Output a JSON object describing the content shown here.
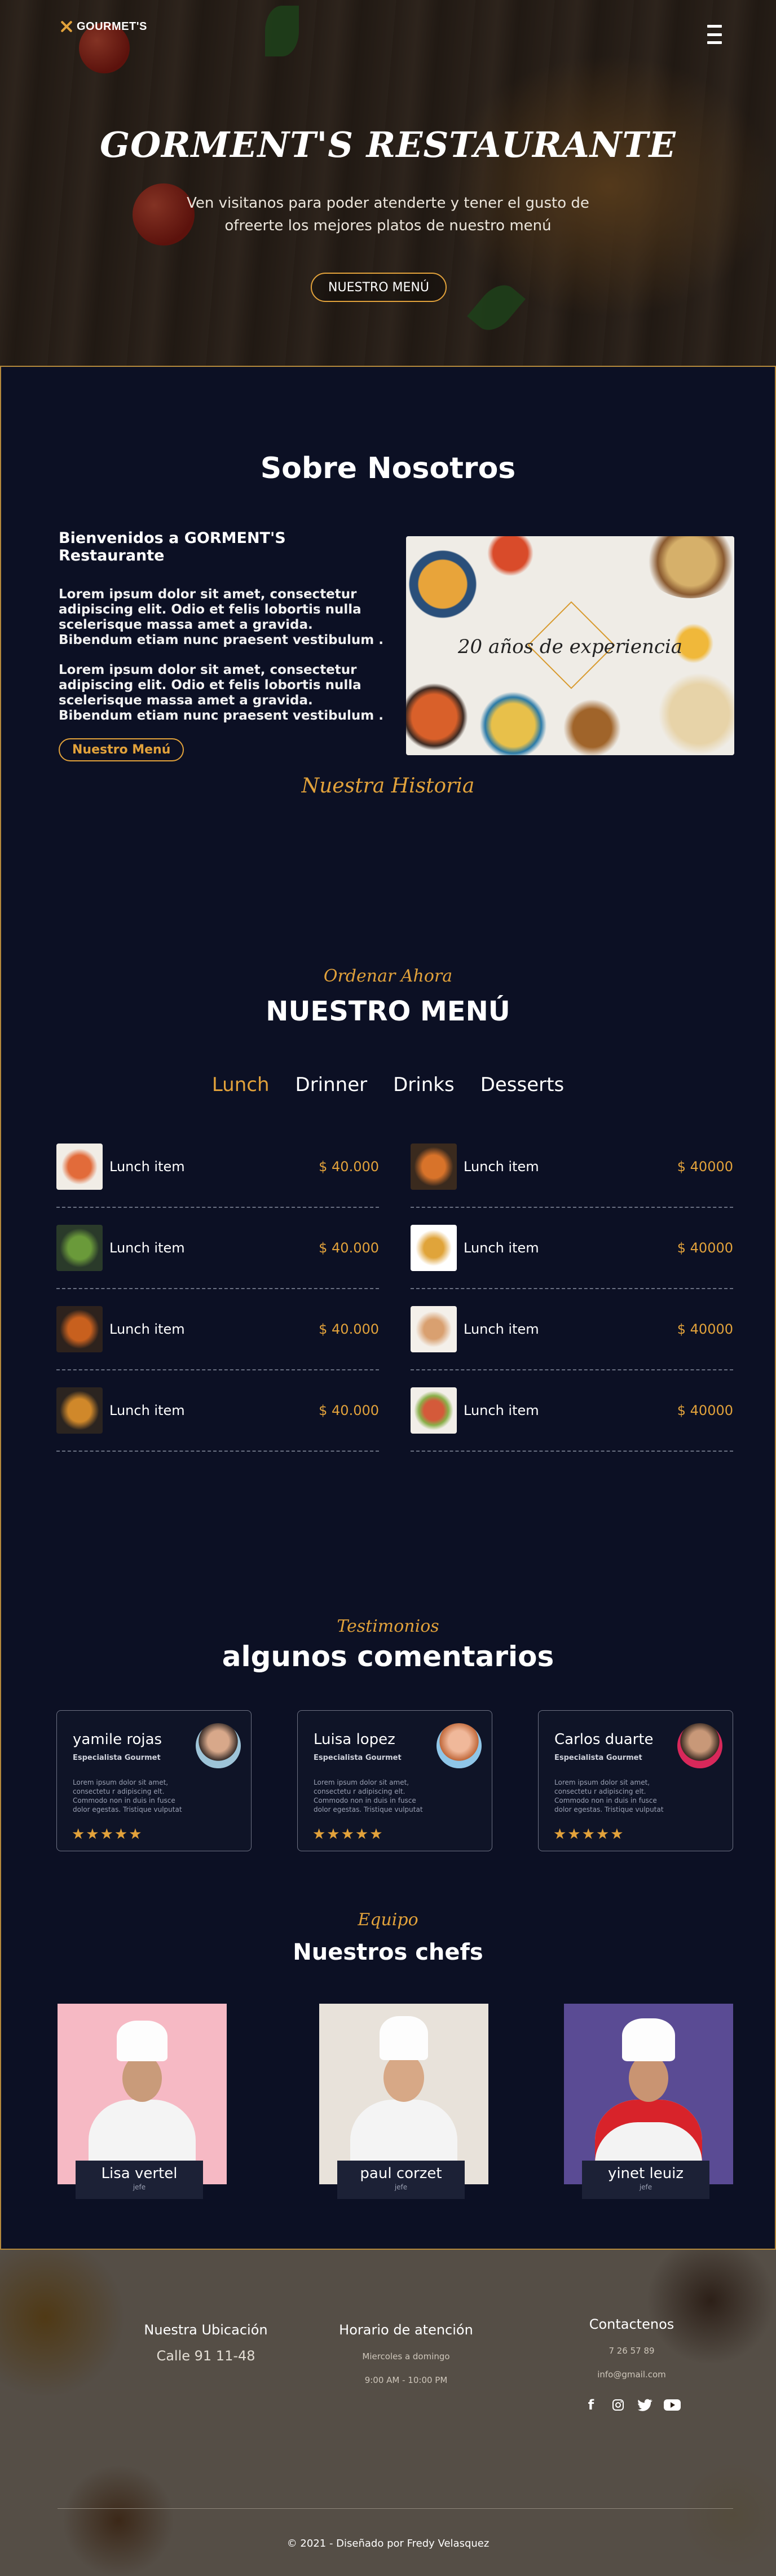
{
  "brand": {
    "logo_text": "GOURMET'S"
  },
  "hero": {
    "title": "GORMENT'S RESTAURANTE",
    "subtitle": "Ven visitanos para poder atenderte y tener el gusto de ofreerte los mejores platos de nuestro menú",
    "cta": "NUESTRO MENÚ"
  },
  "about": {
    "kicker": "Nuestra Historia",
    "title": "Sobre Nosotros",
    "heading": "Bienvenidos a GORMENT'S Restaurante",
    "paragraphs": [
      "Lorem ipsum dolor sit amet, consectetur adipiscing elit. Odio et felis lobortis nulla scelerisque massa amet a gravida. Bibendum etiam nunc praesent vestibulum .",
      "Lorem ipsum dolor sit amet, consectetur adipiscing elit. Odio et felis lobortis nulla scelerisque massa amet a gravida. Bibendum etiam nunc praesent vestibulum ."
    ],
    "button": "Nuestro Menú",
    "image_caption": "20 años de experiencia"
  },
  "menu": {
    "kicker": "Ordenar Ahora",
    "title": "NUESTRO MENÚ",
    "tabs": [
      "Lunch",
      "Drinner",
      "Drinks",
      "Desserts"
    ],
    "active_tab": "Lunch",
    "items": [
      {
        "name": "Lunch item",
        "price": "$ 40.000"
      },
      {
        "name": "Lunch item",
        "price": "$ 40000"
      },
      {
        "name": "Lunch item",
        "price": "$ 40.000"
      },
      {
        "name": "Lunch item",
        "price": "$ 40000"
      },
      {
        "name": "Lunch item",
        "price": "$ 40.000"
      },
      {
        "name": "Lunch item",
        "price": "$ 40000"
      },
      {
        "name": "Lunch item",
        "price": "$ 40.000"
      },
      {
        "name": "Lunch item",
        "price": "$ 40000"
      }
    ]
  },
  "testimonials": {
    "kicker": "Testimonios",
    "title": "algunos comentarios",
    "cards": [
      {
        "name": "yamile rojas",
        "role": "Especialista Gourmet",
        "text": "Lorem ipsum dolor sit amet, consectetu r adipiscing elt. Commodo non in duis in fusce dolor egestas. Tristique vulputat",
        "stars": "★★★★★"
      },
      {
        "name": "Luisa lopez",
        "role": "Especialista Gourmet",
        "text": "Lorem ipsum dolor sit amet, consectetu r adipiscing elt. Commodo non in duis in fusce dolor egestas. Tristique vulputat",
        "stars": "★★★★★"
      },
      {
        "name": "Carlos duarte",
        "role": "Especialista Gourmet",
        "text": "Lorem ipsum dolor sit amet, consectetu r adipiscing elt. Commodo non in duis in fusce dolor egestas. Tristique vulputat",
        "stars": "★★★★★"
      }
    ]
  },
  "chefs": {
    "kicker": "Equipo",
    "title": "Nuestros chefs",
    "list": [
      {
        "name": "Lisa vertel",
        "role": "jefe"
      },
      {
        "name": "paul corzet",
        "role": "jefe"
      },
      {
        "name": "yinet leuiz",
        "role": "jefe"
      }
    ]
  },
  "footer": {
    "location_title": "Nuestra Ubicación",
    "location_value": "Calle 91 11-48",
    "hours_title": "Horario de atención",
    "hours_days": "Miercoles a domingo",
    "hours_time": "9:00 AM - 10:00 PM",
    "contact_title": "Contactenos",
    "phone": "7 26 57 89",
    "email": "info@gmail.com",
    "copyright": "© 2021 - Diseñado por Fredy Velasquez"
  },
  "colors": {
    "accent": "#e2a23b",
    "background": "#0c1024"
  }
}
